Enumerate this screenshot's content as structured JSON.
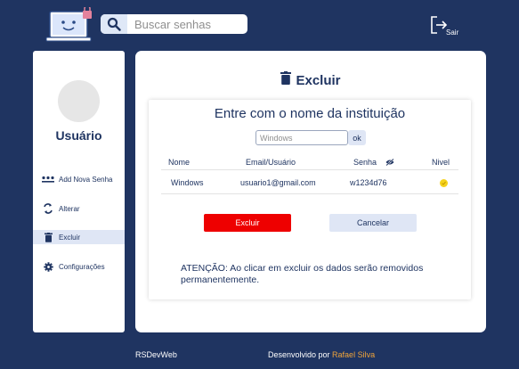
{
  "header": {
    "search": {
      "placeholder": "Buscar senhas",
      "icon": "search-icon"
    },
    "logout_label": "Sair"
  },
  "sidebar": {
    "user_name": "Usuário",
    "items": [
      {
        "label": "Add Nova Senha",
        "icon": "dots-icon"
      },
      {
        "label": "Alterar",
        "icon": "swap-icon"
      },
      {
        "label": "Excluir",
        "icon": "trash-icon",
        "active": true
      },
      {
        "label": "Configurações",
        "icon": "gear-icon"
      }
    ]
  },
  "main": {
    "title": "Excluir",
    "form": {
      "heading": "Entre com o nome da instituição",
      "input_placeholder": "Windows",
      "ok_label": "ok"
    },
    "table": {
      "columns": [
        "Nome",
        "Email/Usuário",
        "Senha",
        "Nivel"
      ],
      "rows": [
        {
          "nome": "Windows",
          "email": "usuario1@gmail.com",
          "senha": "w1234d76",
          "nivel": "medium"
        }
      ]
    },
    "buttons": {
      "delete": "Excluir",
      "cancel": "Cancelar"
    },
    "warning": "ATENÇÃO: Ao clicar em excluir os dados serão removidos permanentemente."
  },
  "footer": {
    "brand": "RSDevWeb",
    "credit_prefix": "Desenvolvido por ",
    "author": "Rafael Silva"
  },
  "colors": {
    "background": "#1f3461",
    "accent_light": "#dfe6f5",
    "danger": "#ee0000",
    "author_link": "#f0a43a",
    "level_indicator": "#f5d31c"
  }
}
